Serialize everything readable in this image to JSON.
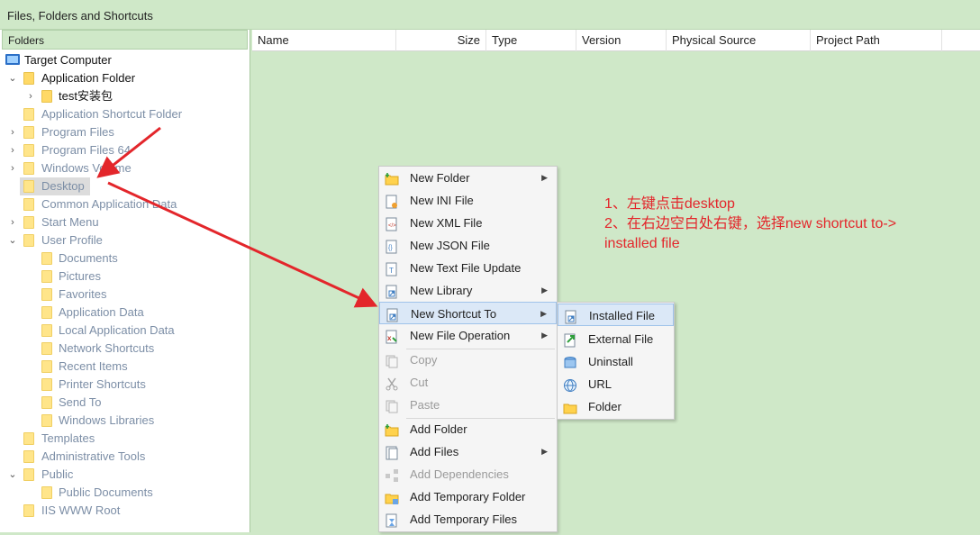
{
  "window": {
    "title": "Files, Folders and Shortcuts"
  },
  "left_pane": {
    "header": "Folders",
    "tree": [
      {
        "label": "Target Computer",
        "icon": "computer-icon",
        "indent": 0,
        "chevron": "",
        "style": "dark"
      },
      {
        "label": "Application Folder",
        "icon": "folder-icon",
        "indent": 1,
        "chevron": "expanded",
        "style": "dark"
      },
      {
        "label": "test安装包",
        "icon": "folder-icon",
        "indent": 2,
        "chevron": "collapsed",
        "style": "dark"
      },
      {
        "label": "Application Shortcut Folder",
        "icon": "folder-icon",
        "indent": 1,
        "chevron": "",
        "style": "grey"
      },
      {
        "label": "Program Files",
        "icon": "folder-icon",
        "indent": 1,
        "chevron": "collapsed",
        "style": "grey"
      },
      {
        "label": "Program Files 64",
        "icon": "folder-icon",
        "indent": 1,
        "chevron": "collapsed",
        "style": "grey"
      },
      {
        "label": "Windows Volume",
        "icon": "folder-icon",
        "indent": 1,
        "chevron": "collapsed",
        "style": "grey"
      },
      {
        "label": "Desktop",
        "icon": "folder-icon",
        "indent": 1,
        "chevron": "",
        "style": "grey",
        "selected": true
      },
      {
        "label": "Common Application Data",
        "icon": "folder-icon",
        "indent": 1,
        "chevron": "",
        "style": "grey"
      },
      {
        "label": "Start Menu",
        "icon": "folder-icon",
        "indent": 1,
        "chevron": "collapsed",
        "style": "grey"
      },
      {
        "label": "User Profile",
        "icon": "folder-icon",
        "indent": 1,
        "chevron": "expanded",
        "style": "grey"
      },
      {
        "label": "Documents",
        "icon": "folder-icon",
        "indent": 2,
        "chevron": "",
        "style": "grey"
      },
      {
        "label": "Pictures",
        "icon": "folder-icon",
        "indent": 2,
        "chevron": "",
        "style": "grey"
      },
      {
        "label": "Favorites",
        "icon": "folder-icon",
        "indent": 2,
        "chevron": "",
        "style": "grey"
      },
      {
        "label": "Application Data",
        "icon": "folder-icon",
        "indent": 2,
        "chevron": "",
        "style": "grey"
      },
      {
        "label": "Local Application Data",
        "icon": "folder-icon",
        "indent": 2,
        "chevron": "",
        "style": "grey"
      },
      {
        "label": "Network Shortcuts",
        "icon": "folder-icon",
        "indent": 2,
        "chevron": "",
        "style": "grey"
      },
      {
        "label": "Recent Items",
        "icon": "folder-icon",
        "indent": 2,
        "chevron": "",
        "style": "grey"
      },
      {
        "label": "Printer Shortcuts",
        "icon": "folder-icon",
        "indent": 2,
        "chevron": "",
        "style": "grey"
      },
      {
        "label": "Send To",
        "icon": "folder-icon",
        "indent": 2,
        "chevron": "",
        "style": "grey"
      },
      {
        "label": "Windows Libraries",
        "icon": "folder-icon",
        "indent": 2,
        "chevron": "",
        "style": "grey"
      },
      {
        "label": "Templates",
        "icon": "folder-icon",
        "indent": 1,
        "chevron": "",
        "style": "grey"
      },
      {
        "label": "Administrative Tools",
        "icon": "folder-icon",
        "indent": 1,
        "chevron": "",
        "style": "grey"
      },
      {
        "label": "Public",
        "icon": "folder-icon",
        "indent": 1,
        "chevron": "expanded",
        "style": "grey"
      },
      {
        "label": "Public Documents",
        "icon": "folder-icon",
        "indent": 2,
        "chevron": "",
        "style": "grey"
      },
      {
        "label": "IIS WWW Root",
        "icon": "folder-icon",
        "indent": 1,
        "chevron": "",
        "style": "grey"
      }
    ]
  },
  "columns": [
    "Name",
    "Size",
    "Type",
    "Version",
    "Physical Source",
    "Project Path"
  ],
  "context_menu": {
    "items": [
      {
        "label": "New Folder",
        "icon": "new-folder-icon",
        "submenu": true,
        "disabled": false
      },
      {
        "label": "New INI File",
        "icon": "ini-file-icon",
        "submenu": false,
        "disabled": false
      },
      {
        "label": "New XML File",
        "icon": "xml-file-icon",
        "submenu": false,
        "disabled": false
      },
      {
        "label": "New JSON File",
        "icon": "json-file-icon",
        "submenu": false,
        "disabled": false
      },
      {
        "label": "New Text File Update",
        "icon": "text-file-icon",
        "submenu": false,
        "disabled": false
      },
      {
        "label": "New Library",
        "icon": "library-icon",
        "submenu": true,
        "disabled": false
      },
      {
        "label": "New Shortcut To",
        "icon": "shortcut-icon",
        "submenu": true,
        "disabled": false,
        "highlighted": true
      },
      {
        "label": "New File Operation",
        "icon": "file-operation-icon",
        "submenu": true,
        "disabled": false
      },
      {
        "separator": true
      },
      {
        "label": "Copy",
        "icon": "copy-icon",
        "submenu": false,
        "disabled": true
      },
      {
        "label": "Cut",
        "icon": "cut-icon",
        "submenu": false,
        "disabled": true
      },
      {
        "label": "Paste",
        "icon": "paste-icon",
        "submenu": false,
        "disabled": true
      },
      {
        "separator": true
      },
      {
        "label": "Add Folder",
        "icon": "add-folder-icon",
        "submenu": false,
        "disabled": false
      },
      {
        "label": "Add Files",
        "icon": "add-files-icon",
        "submenu": true,
        "disabled": false
      },
      {
        "label": "Add Dependencies",
        "icon": "dependencies-icon",
        "submenu": false,
        "disabled": true
      },
      {
        "label": "Add Temporary Folder",
        "icon": "temp-folder-icon",
        "submenu": false,
        "disabled": false
      },
      {
        "label": "Add Temporary Files",
        "icon": "temp-files-icon",
        "submenu": false,
        "disabled": false
      }
    ]
  },
  "submenu": {
    "items": [
      {
        "label": "Installed File",
        "icon": "installed-file-icon",
        "highlighted": true
      },
      {
        "label": "External File",
        "icon": "external-file-icon"
      },
      {
        "label": "Uninstall",
        "icon": "uninstall-icon"
      },
      {
        "label": "URL",
        "icon": "url-icon"
      },
      {
        "label": "Folder",
        "icon": "folder-icon"
      }
    ]
  },
  "annotation": {
    "lines": [
      "1、左键点击desktop",
      "2、在右边空白处右键，选择new shortcut to->",
      "installed file"
    ],
    "color": "#e3262b"
  },
  "colors": {
    "background": "#cfe8c8",
    "folder": "#ffd966",
    "highlight": "#dbe8f7",
    "grey_text": "#7c8ea6"
  }
}
